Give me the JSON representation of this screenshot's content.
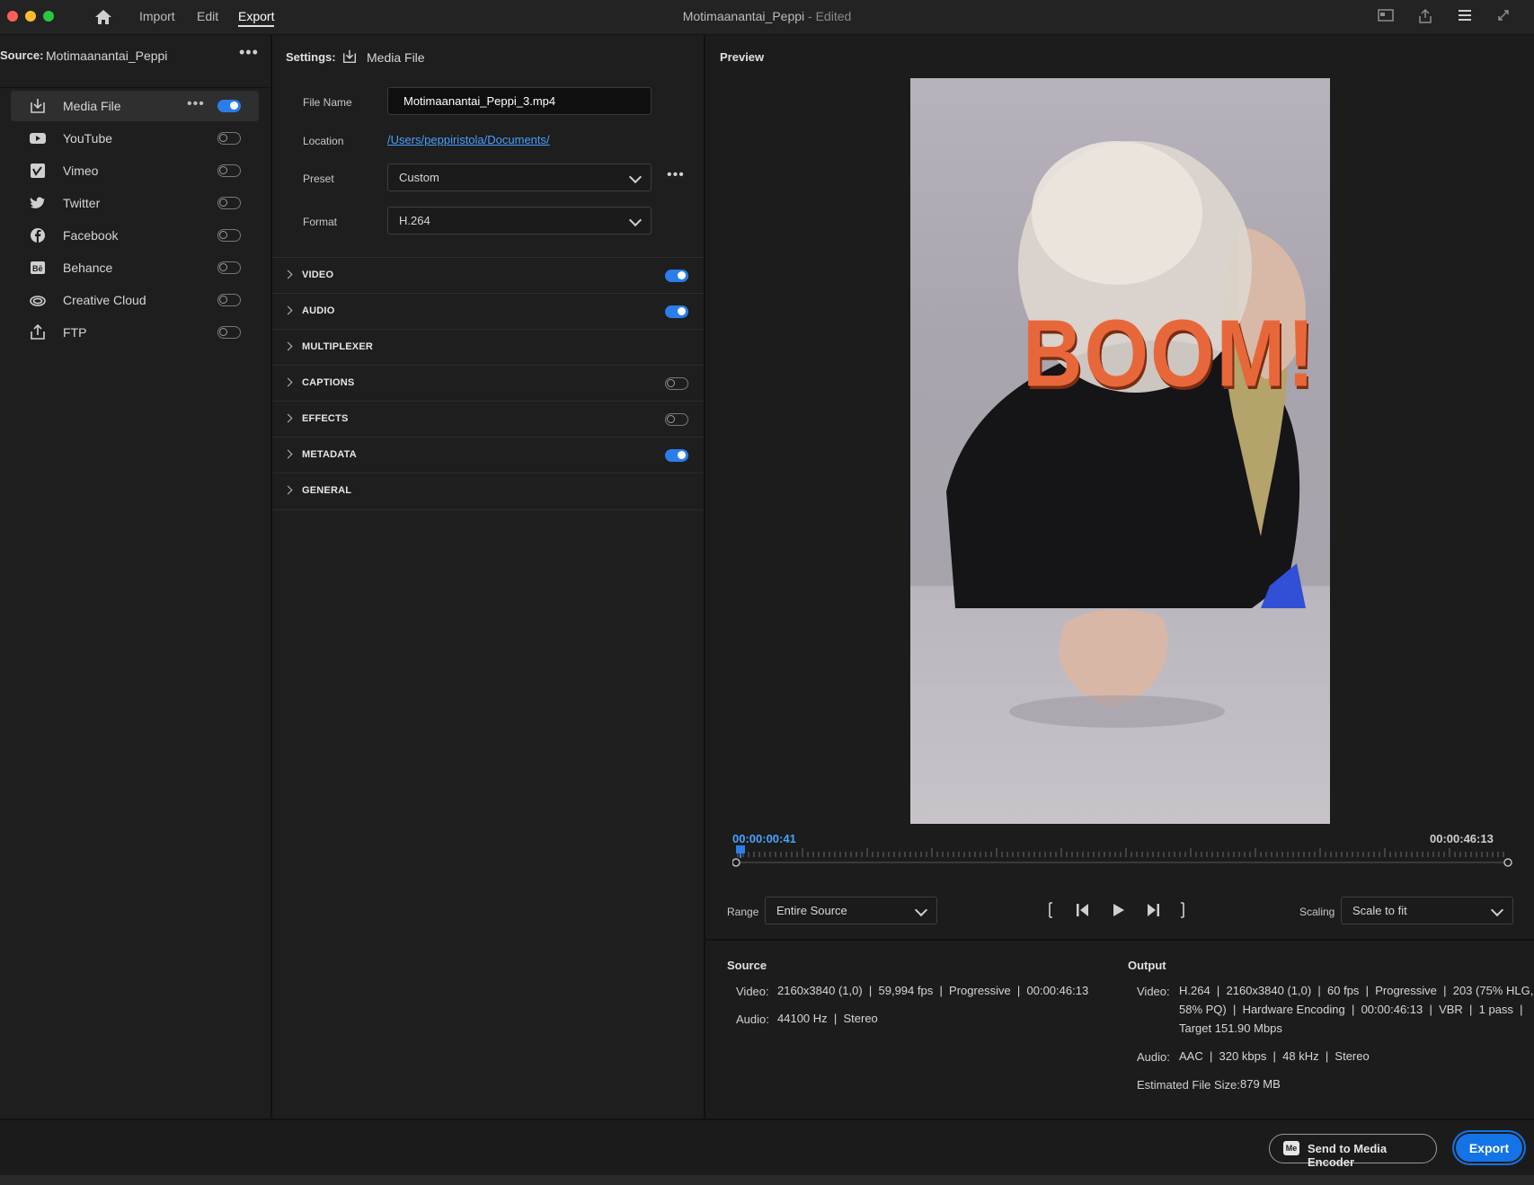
{
  "menu": {
    "import": "Import",
    "edit": "Edit",
    "export": "Export"
  },
  "window": {
    "title": "Motimaanantai_Peppi",
    "status": "- Edited"
  },
  "source": {
    "label": "Source:",
    "name": "Motimaanantai_Peppi"
  },
  "destinations": [
    {
      "label": "Media File",
      "icon": "media-file-icon",
      "enabled": true
    },
    {
      "label": "YouTube",
      "icon": "youtube-icon",
      "enabled": false
    },
    {
      "label": "Vimeo",
      "icon": "vimeo-icon",
      "enabled": false
    },
    {
      "label": "Twitter",
      "icon": "twitter-icon",
      "enabled": false
    },
    {
      "label": "Facebook",
      "icon": "facebook-icon",
      "enabled": false
    },
    {
      "label": "Behance",
      "icon": "behance-icon",
      "enabled": false
    },
    {
      "label": "Creative Cloud",
      "icon": "creative-cloud-icon",
      "enabled": false
    },
    {
      "label": "FTP",
      "icon": "ftp-icon",
      "enabled": false
    }
  ],
  "settings": {
    "label": "Settings:",
    "target": "Media File",
    "file_name_label": "File Name",
    "file_name": "Motimaanantai_Peppi_3.mp4",
    "location_label": "Location",
    "location": "/Users/peppiristola/Documents/",
    "preset_label": "Preset",
    "preset": "Custom",
    "format_label": "Format",
    "format": "H.264",
    "sections": [
      {
        "name": "VIDEO",
        "toggle": "on"
      },
      {
        "name": "AUDIO",
        "toggle": "on"
      },
      {
        "name": "MULTIPLEXER",
        "toggle": "none"
      },
      {
        "name": "CAPTIONS",
        "toggle": "off"
      },
      {
        "name": "EFFECTS",
        "toggle": "off"
      },
      {
        "name": "METADATA",
        "toggle": "on"
      },
      {
        "name": "GENERAL",
        "toggle": "none"
      }
    ]
  },
  "preview": {
    "title": "Preview",
    "overlay_text": "BOOM!",
    "current_time": "00:00:00:41",
    "duration": "00:00:46:13",
    "range_label": "Range",
    "range": "Entire Source",
    "scaling_label": "Scaling",
    "scaling": "Scale to fit"
  },
  "source_info": {
    "title": "Source",
    "video_label": "Video:",
    "video": "2160x3840 (1,0)  |  59,994 fps  |  Progressive  |  00:00:46:13",
    "audio_label": "Audio:",
    "audio": "44100 Hz  |  Stereo"
  },
  "output_info": {
    "title": "Output",
    "video_label": "Video:",
    "video_line1": "H.264  |  2160x3840 (1,0)  |  60 fps  |  Progressive  |  203 (75% HLG,",
    "video_line2": "58% PQ)  |  Hardware Encoding  |  00:00:46:13  |  VBR  |  1 pass  |",
    "video_line3": "Target 151.90 Mbps",
    "audio_label": "Audio:",
    "audio": "AAC  |  320 kbps  |  48 kHz  |  Stereo",
    "size_label": "Estimated File Size:",
    "size": "879 MB"
  },
  "actions": {
    "send_to_encoder": "Send to Media Encoder",
    "encoder_badge": "Me",
    "export": "Export"
  },
  "colors": {
    "accent": "#2b7de9",
    "link": "#4a9eff",
    "timecode": "#4aa3ff",
    "overlay": "#e8673a"
  }
}
